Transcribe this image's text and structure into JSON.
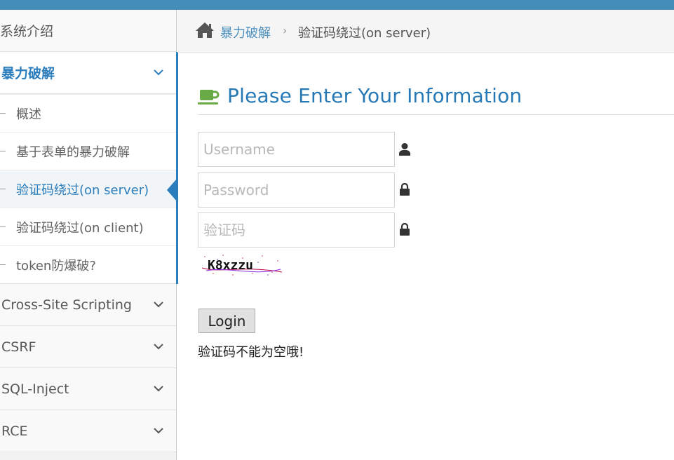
{
  "sidebar": {
    "top_item": "·系统介绍",
    "active_group": "暴力破解",
    "sub_items": [
      "概述",
      "基于表单的暴力破解",
      "验证码绕过(on server)",
      "验证码绕过(on client)",
      "token防爆破?"
    ],
    "groups": [
      "Cross-Site Scripting",
      "CSRF",
      "SQL-Inject",
      "RCE"
    ]
  },
  "breadcrumb": {
    "link": "暴力破解",
    "separator": "›",
    "current": "验证码绕过(on server)"
  },
  "header": {
    "title": "Please Enter Your Information"
  },
  "form": {
    "username_placeholder": "Username",
    "password_placeholder": "Password",
    "code_placeholder": "验证码",
    "captcha_text": "K8xzzu",
    "login_label": "Login",
    "message": "验证码不能为空哦!"
  },
  "colors": {
    "accent": "#438eb9",
    "link": "#2b7dbc",
    "cup": "#69aa46"
  }
}
